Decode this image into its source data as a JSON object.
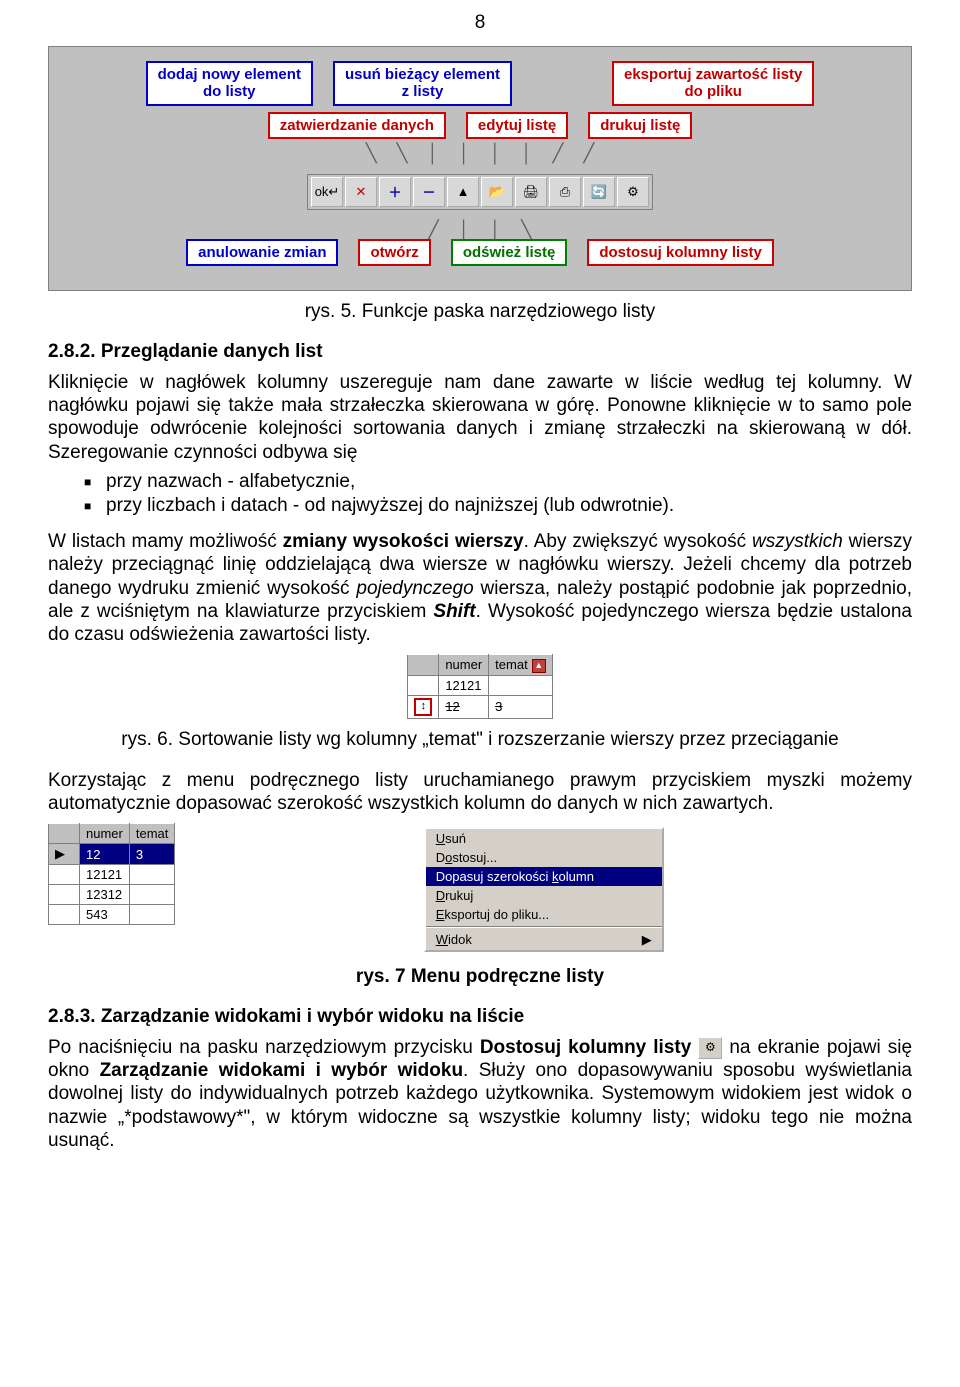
{
  "page_number": "8",
  "diagram_top_labels": {
    "l1": "dodaj nowy element\ndo listy",
    "l2": "usuń bieżący element\nz listy",
    "l3": "eksportuj zawartość listy\ndo pliku"
  },
  "diagram_mid_labels": {
    "l1": "zatwierdzanie danych",
    "l2": "edytuj listę",
    "l3": "drukuj listę"
  },
  "diagram_bottom_labels": {
    "l1": "anulowanie zmian",
    "l2": "otwórz",
    "l3": "odśwież listę",
    "l4": "dostosuj kolumny listy"
  },
  "toolbar_btns": [
    "ok↵",
    "✕",
    "＋",
    "－",
    "▲",
    "📂",
    "🖨",
    "⎙",
    "🔄",
    "⚙"
  ],
  "caption5": "rys. 5. Funkcje paska narzędziowego listy",
  "section282_heading": "2.8.2.  Przeglądanie danych list",
  "para1": "Kliknięcie w nagłówek kolumny uszereguje nam dane zawarte w liście według tej kolumny. W nagłówku pojawi się także mała strzałeczka skierowana w górę. Ponowne kliknięcie w to samo pole spowoduje odwrócenie kolejności sortowania danych i zmianę strzałeczki na skierowaną w dół. Szeregowanie czynności odbywa się",
  "bullets": {
    "b1": "przy nazwach  - alfabetycznie,",
    "b2": "przy liczbach  i datach  - od najwyższej do najniższej (lub odwrotnie)."
  },
  "para2a": "W listach mamy możliwość ",
  "para2b_bold": "zmiany wysokości wierszy",
  "para2c": ". Aby zwiększyć wysokość ",
  "para2d_italic": "wszystkich",
  "para2e": " wierszy należy przeciągnąć linię oddzielającą dwa wiersze w nagłówku wierszy. Jeżeli chcemy dla potrzeb danego wydruku zmienić wysokość ",
  "para2f_italic": "pojedynczego",
  "para2g": " wiersza, należy postąpić podobnie jak poprzednio, ale z wciśniętym na klawiaturze przyciskiem ",
  "para2h_bolditalic": "Shift",
  "para2i": ". Wysokość pojedynczego wiersza będzie ustalona do czasu odświeżenia zawartości listy.",
  "tbl1": {
    "h1": "numer",
    "h2": "temat",
    "r1c1": "12121",
    "r1c2": "",
    "r2c1": "12",
    "r2c2": "3"
  },
  "caption6": "rys. 6. Sortowanie listy wg kolumny „temat\" i rozszerzanie wierszy przez przeciąganie",
  "para3": "Korzystając z menu podręcznego listy uruchamianego prawym przyciskiem myszki możemy automatycznie dopasować szerokość wszystkich kolumn do danych w nich zawartych.",
  "tbl2": {
    "h1": "numer",
    "h2": "temat",
    "r1": "12",
    "r1b": "3",
    "r2": "12121",
    "r3": "12312",
    "r4": "543"
  },
  "ctx": {
    "i1": "Usuń",
    "i2": "Dostosuj...",
    "i3": "Dopasuj szerokości kolumn",
    "i4": "Drukuj",
    "i5": "Eksportuj do pliku...",
    "i6": "Widok"
  },
  "caption7": "rys. 7 Menu podręczne listy",
  "section283_heading": "2.8.3.  Zarządzanie widokami i wybór widoku na liście",
  "para4a": "Po naciśnięciu na pasku narzędziowym przycisku ",
  "para4b_bold": "Dostosuj kolumny listy",
  "para4c": "  na ekranie pojawi się okno ",
  "para4d_bold": "Zarządzanie widokami i wybór widoku",
  "para4e": ". Służy ono dopasowywaniu sposobu wyświetlania dowolnej listy do indywidualnych potrzeb każdego użytkownika. Systemowym widokiem jest widok o nazwie „*podstawowy*\", w którym widoczne są wszystkie kolumny listy; widoku tego nie można usunąć."
}
